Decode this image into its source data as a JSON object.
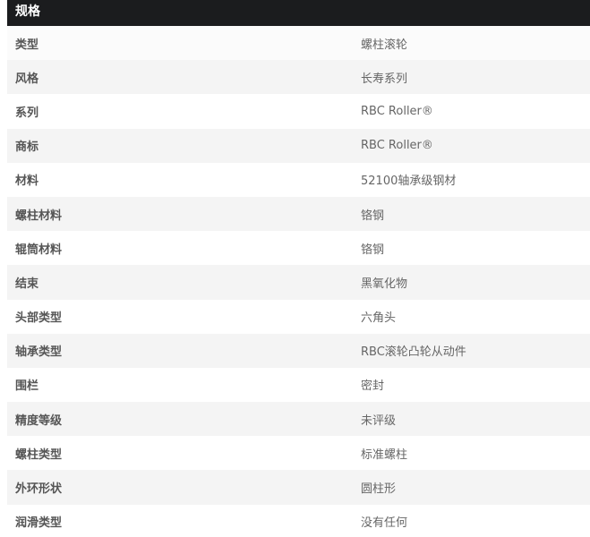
{
  "spec": {
    "header": "规格",
    "rows": [
      {
        "label": "类型",
        "value": "螺柱滚轮"
      },
      {
        "label": "风格",
        "value": "长寿系列"
      },
      {
        "label": "系列",
        "value": "RBC Roller®"
      },
      {
        "label": "商标",
        "value": "RBC Roller®"
      },
      {
        "label": "材料",
        "value": "52100轴承级钢材"
      },
      {
        "label": "螺柱材料",
        "value": "铬钢"
      },
      {
        "label": "辊筒材料",
        "value": "铬钢"
      },
      {
        "label": "结束",
        "value": "黑氧化物"
      },
      {
        "label": "头部类型",
        "value": "六角头"
      },
      {
        "label": "轴承类型",
        "value": "RBC滚轮凸轮从动件"
      },
      {
        "label": "围栏",
        "value": "密封"
      },
      {
        "label": "精度等级",
        "value": "未评级"
      },
      {
        "label": "螺柱类型",
        "value": "标准螺柱"
      },
      {
        "label": "外环形状",
        "value": "圆柱形"
      },
      {
        "label": "润滑类型",
        "value": "没有任何"
      }
    ]
  },
  "colors": {
    "header_bg": "#1b1c1e",
    "row_alt_bg": "#f4f4f4",
    "label_text": "#555555",
    "value_text": "#666666"
  }
}
